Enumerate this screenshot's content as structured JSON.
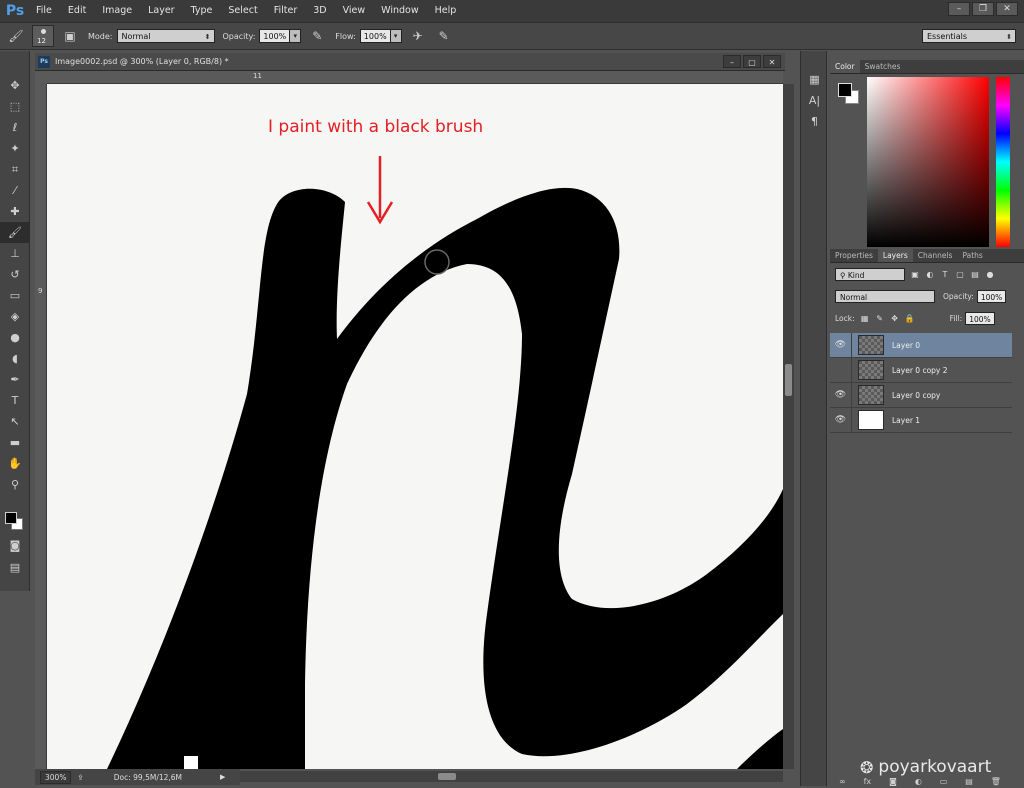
{
  "app": {
    "logo": "Ps",
    "menu": [
      "File",
      "Edit",
      "Image",
      "Layer",
      "Type",
      "Select",
      "Filter",
      "3D",
      "View",
      "Window",
      "Help"
    ],
    "window_controls": [
      "–",
      "❐",
      "✕"
    ]
  },
  "options_bar": {
    "brush_size": "12",
    "mode_label": "Mode:",
    "mode_value": "Normal",
    "opacity_label": "Opacity:",
    "opacity_value": "100%",
    "flow_label": "Flow:",
    "flow_value": "100%",
    "workspace": "Essentials"
  },
  "document": {
    "title": "Image0002.psd @ 300% (Layer 0, RGB/8) *",
    "ruler_top_mark": "11",
    "ruler_left_mark": "9",
    "annotation": "I paint with a black brush",
    "annotation_color": "#e31e24",
    "zoom": "300%",
    "doc_size": "Doc: 99,5M/12,6M"
  },
  "color_panel": {
    "tabs": [
      "Color",
      "Swatches"
    ],
    "foreground": "#000000",
    "background": "#ffffff"
  },
  "layers_panel": {
    "tabs": [
      "Properties",
      "Layers",
      "Channels",
      "Paths"
    ],
    "active_tab": "Layers",
    "kind": "Kind",
    "blend_mode": "Normal",
    "opacity_label": "Opacity:",
    "opacity_value": "100%",
    "lock_label": "Lock:",
    "fill_label": "Fill:",
    "fill_value": "100%",
    "layers": [
      {
        "name": "Layer 0",
        "visible": true,
        "selected": true,
        "thumb": "transparent"
      },
      {
        "name": "Layer 0 copy 2",
        "visible": false,
        "selected": false,
        "thumb": "transparent"
      },
      {
        "name": "Layer 0 copy",
        "visible": true,
        "selected": false,
        "thumb": "transparent"
      },
      {
        "name": "Layer 1",
        "visible": true,
        "selected": false,
        "thumb": "white"
      }
    ]
  },
  "watermark": "poyarkovaart"
}
